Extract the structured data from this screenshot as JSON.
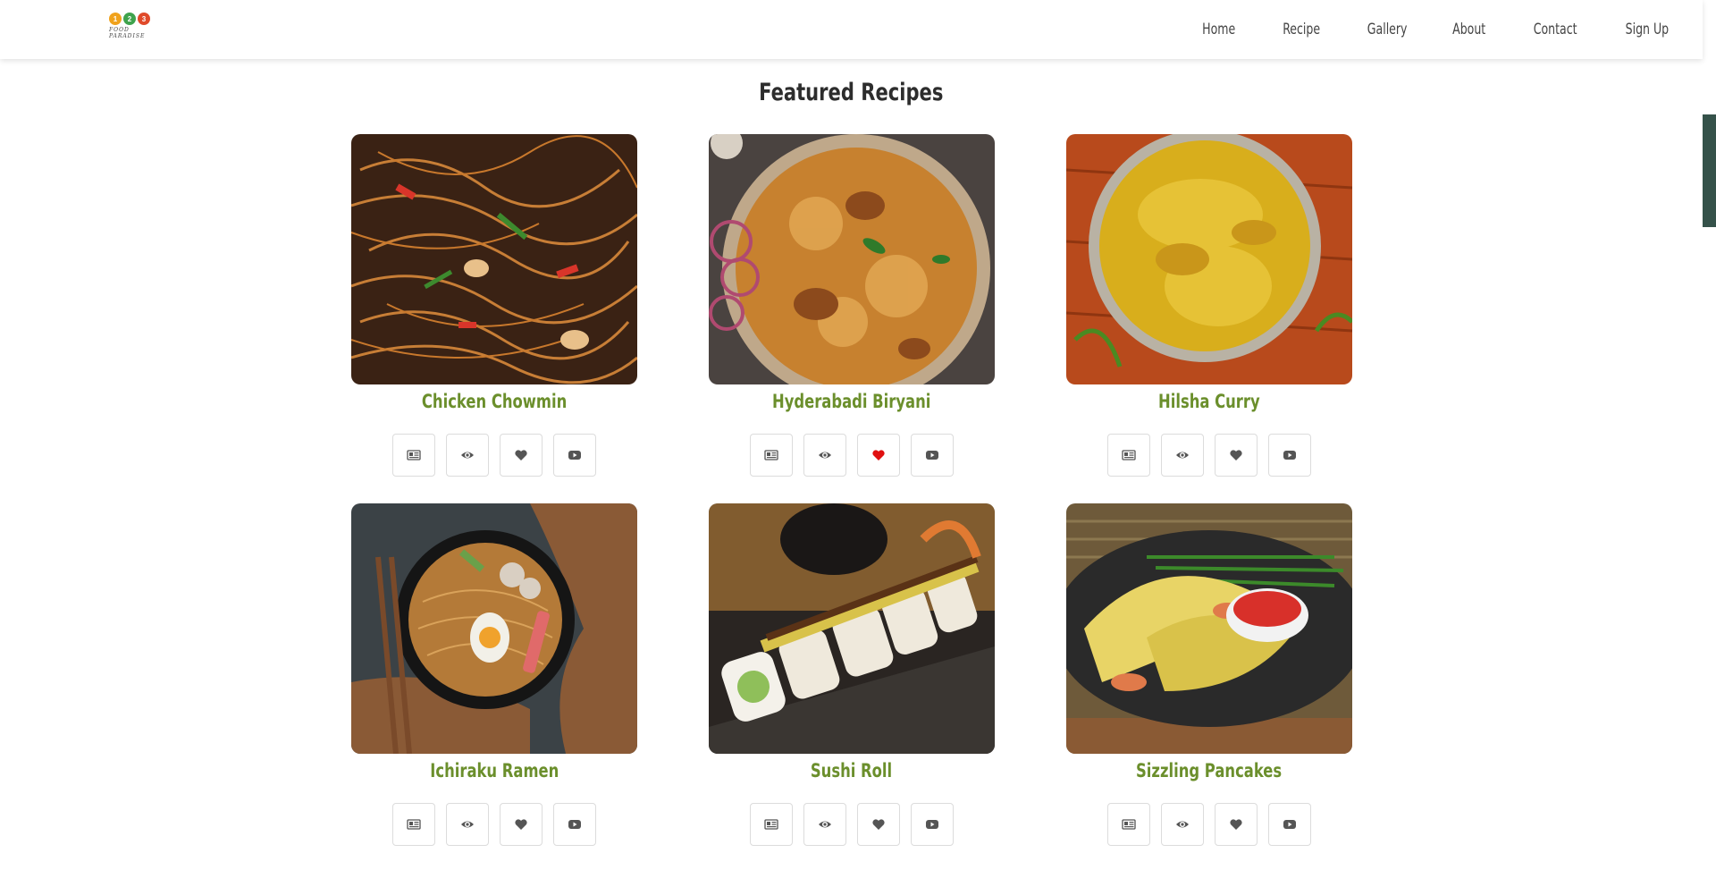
{
  "nav": {
    "logo_letters": [
      "1",
      "2",
      "3"
    ],
    "logo_tag": "FOOD PARADISE",
    "items": [
      "Home",
      "Recipe",
      "Gallery",
      "About",
      "Contact",
      "Sign Up"
    ]
  },
  "section": {
    "title": "Featured Recipes"
  },
  "recipes": [
    {
      "name": "Chicken Chowmin",
      "favorited": false
    },
    {
      "name": "Hyderabadi Biryani",
      "favorited": true
    },
    {
      "name": "Hilsha Curry",
      "favorited": false
    },
    {
      "name": "Ichiraku Ramen",
      "favorited": false
    },
    {
      "name": "Sushi Roll",
      "favorited": false
    },
    {
      "name": "Sizzling Pancakes",
      "favorited": false
    }
  ],
  "colors": {
    "recipe_name": "#6b8f2c",
    "favorite_active": "#e01010",
    "icon": "#555555",
    "scroll_thumb": "#35524a"
  },
  "icons": [
    "newspaper-icon",
    "eye-icon",
    "heart-icon",
    "youtube-icon"
  ]
}
